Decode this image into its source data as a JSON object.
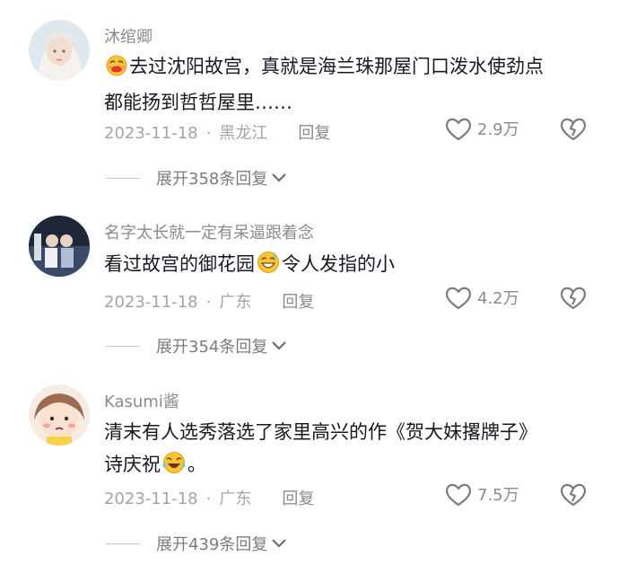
{
  "comments": [
    {
      "username": "沐绾卿",
      "emoji": "smiling-blush-emoji",
      "text_lines": [
        "去过沈阳故宫，真就是海兰珠那屋门口泼水使劲点",
        "都能扬到哲哲屋里……"
      ],
      "date": "2023-11-18",
      "dot": "·",
      "location": "黑龙江",
      "reply_label": "回复",
      "likes": "2.9万",
      "expand_label": "展开358条回复"
    },
    {
      "username": "名字太长就一定有呆逼跟着念",
      "text_before": "看过故宫的御花园",
      "emoji": "grin-sweat-emoji",
      "text_after": "令人发指的小",
      "date": "2023-11-18",
      "dot": "·",
      "location": "广东",
      "reply_label": "回复",
      "likes": "4.2万",
      "expand_label": "展开354条回复"
    },
    {
      "username": "Kasumi酱",
      "text_lines": [
        "清末有人选秀落选了家里高兴的作《贺大妹撂牌子》"
      ],
      "text_line2_before": "诗庆祝",
      "emoji": "rolling-laugh-emoji",
      "text_line2_after": "。",
      "date": "2023-11-18",
      "dot": "·",
      "location": "广东",
      "reply_label": "回复",
      "likes": "7.5万",
      "expand_label": "展开439条回复"
    }
  ]
}
